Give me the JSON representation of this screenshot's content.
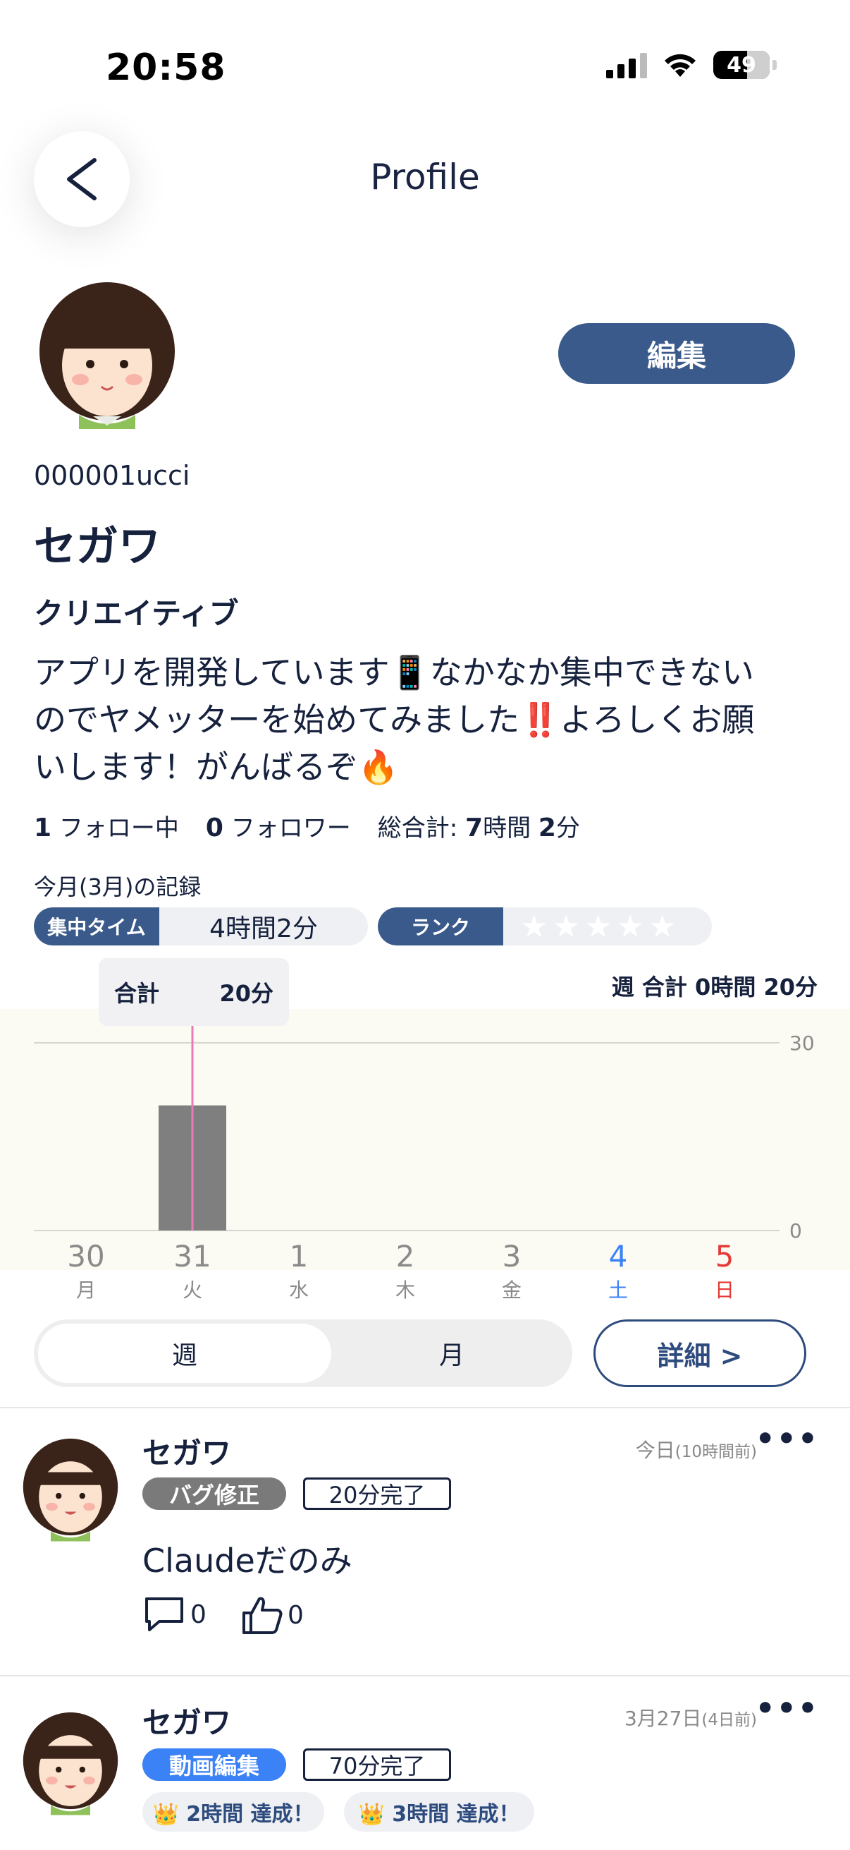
{
  "status_bar": {
    "time": "20:58",
    "battery": "49"
  },
  "header": {
    "title": "Profile"
  },
  "profile": {
    "edit_label": "編集",
    "user_id": "000001ucci",
    "name": "セガワ",
    "occupation": "クリエイティブ",
    "bio": "アプリを開発しています📱なかなか集中できないのでヤメッターを始めてみました‼️よろしくお願いします！がんばるぞ🔥",
    "following_count": "1",
    "following_label": "フォロー中",
    "followers_count": "0",
    "followers_label": "フォロワー",
    "total_label": "総合計:",
    "total_hours": "7",
    "hours_unit": "時間",
    "total_minutes": "2",
    "minutes_unit": "分"
  },
  "monthly": {
    "title": "今月(3月)の記録",
    "focus_label": "集中タイム",
    "focus_value": "4時間2分",
    "rank_label": "ランク",
    "rank_stars": 0,
    "rank_max": 5
  },
  "chart": {
    "tooltip_label": "合計",
    "tooltip_value": "20分",
    "week_total": "週 合計 0時間 20分"
  },
  "chart_data": {
    "type": "bar",
    "categories": [
      "30",
      "31",
      "1",
      "2",
      "3",
      "4",
      "5"
    ],
    "weekdays": [
      "月",
      "火",
      "水",
      "木",
      "金",
      "土",
      "日"
    ],
    "values": [
      0,
      20,
      0,
      0,
      0,
      0,
      0
    ],
    "ylim": [
      0,
      30
    ],
    "yticks": [
      "0",
      "30"
    ],
    "selected_index": 1,
    "colors": {
      "bar": "#7f7f7f",
      "cursor": "#e87bb8",
      "saturday": "#3b82f6",
      "sunday": "#e53935"
    }
  },
  "toggle": {
    "week": "週",
    "month": "月"
  },
  "detail_label": "詳細 >",
  "posts": [
    {
      "name": "セガワ",
      "time": "今日",
      "time_sub": "(10時間前)",
      "tag": "バグ修正",
      "tag_color": "#7a7a7a",
      "duration": "20分完了",
      "body": "Claudeだのみ",
      "comments": "0",
      "likes": "0"
    },
    {
      "name": "セガワ",
      "time": "3月27日",
      "time_sub": "(4日前)",
      "tag": "動画編集",
      "tag_color": "#3b82f6",
      "duration": "70分完了",
      "achievements": [
        "👑 2時間 達成！",
        "👑 3時間 達成！"
      ]
    }
  ]
}
